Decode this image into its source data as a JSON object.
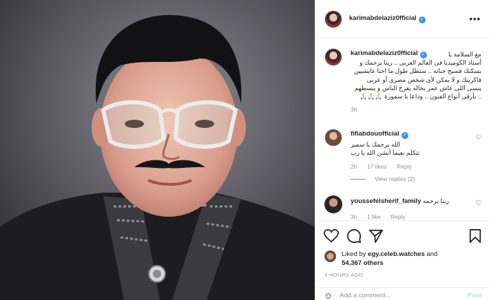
{
  "post": {
    "username": "karimabdelaziz0fficial",
    "more_icon": "more-horizontal-icon",
    "caption": {
      "username": "karimabdelaziz0fficial",
      "lines": [
        "مع السلامة يا",
        "أستاذ الكوميديا فى العالم العربى .. ربنا يرحمك و",
        "يسكنك فسيح جناته .. ستظل طول ما احنا عايشيين",
        "فاكرينك و لا يمكن لأى شخص مصرى أو عربى",
        "ينسى اللى عاش عمر بحاله يفرح الناس و يبسطهم",
        ".. بأرقى أنواع الفنون .. وداعا يا سمورة 🙏🏻🙏🏻🙏🏻"
      ],
      "time": "3h"
    },
    "comments": [
      {
        "username": "fifiabdouofficial",
        "lines": [
          "الله يرحمك يا سمير",
          "تتكلم نعيما أنشن الله يا رب"
        ],
        "time": "2h",
        "likes": "17 likes",
        "reply": "Reply"
      },
      {
        "username": "youssefelsherif_family",
        "lines": [
          "ربنا يرحمه"
        ],
        "time": "3h",
        "likes": "1 like",
        "reply": "Reply"
      }
    ],
    "view_replies": "View replies (2)",
    "liked_by": {
      "prefix": "Liked by ",
      "user": "egy.celeb.watches",
      "joiner": " and",
      "count": "54,367 others"
    },
    "timestamp": "3 HOURS AGO",
    "add_comment": {
      "placeholder": "Add a comment...",
      "post_label": "Post"
    },
    "action_icons": [
      "heart-icon",
      "comment-icon",
      "share-icon",
      "bookmark-icon"
    ]
  }
}
